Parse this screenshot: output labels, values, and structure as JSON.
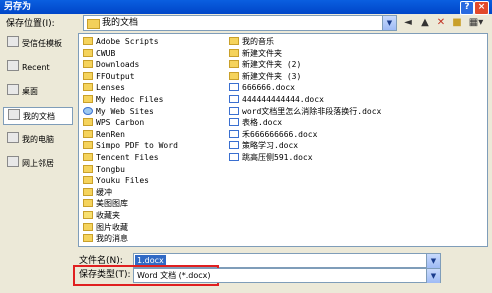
{
  "window": {
    "title": "另存为",
    "help_label": "?",
    "close_label": "×"
  },
  "location": {
    "label": "保存位置(I):",
    "value": "我的文档"
  },
  "toolbar": {
    "icons": [
      "back-icon",
      "up-folder-icon",
      "delete-icon",
      "new-folder-icon",
      "views-icon"
    ]
  },
  "places": [
    {
      "label": "受信任模板",
      "selected": false
    },
    {
      "label": "Recent",
      "selected": false
    },
    {
      "label": "桌面",
      "selected": false
    },
    {
      "label": "我的文档",
      "selected": true
    },
    {
      "label": "我的电脑",
      "selected": false
    },
    {
      "label": "网上邻居",
      "selected": false
    }
  ],
  "files_col1": [
    {
      "name": "Adobe Scripts",
      "type": "folder"
    },
    {
      "name": "CWUB",
      "type": "folder"
    },
    {
      "name": "Downloads",
      "type": "folder"
    },
    {
      "name": "FFOutput",
      "type": "folder"
    },
    {
      "name": "Lenses",
      "type": "folder"
    },
    {
      "name": "My Hedoc Files",
      "type": "folder"
    },
    {
      "name": "My Web Sites",
      "type": "web"
    },
    {
      "name": "WPS Carbon",
      "type": "folder"
    },
    {
      "name": "RenRen",
      "type": "folder"
    },
    {
      "name": "Simpo PDF to Word",
      "type": "folder"
    },
    {
      "name": "Tencent Files",
      "type": "folder"
    },
    {
      "name": "Tongbu",
      "type": "folder"
    },
    {
      "name": "Youku Files",
      "type": "folder"
    },
    {
      "name": "缓冲",
      "type": "folder"
    },
    {
      "name": "美图图库",
      "type": "folder"
    },
    {
      "name": "收藏夹",
      "type": "star"
    },
    {
      "name": "图片收藏",
      "type": "folder"
    },
    {
      "name": "我的消息",
      "type": "folder"
    }
  ],
  "files_col2": [
    {
      "name": "我的音乐",
      "type": "folder"
    },
    {
      "name": "新建文件夹",
      "type": "folder"
    },
    {
      "name": "新建文件夹 (2)",
      "type": "folder"
    },
    {
      "name": "新建文件夹 (3)",
      "type": "folder"
    },
    {
      "name": "666666.docx",
      "type": "doc"
    },
    {
      "name": "444444444444.docx",
      "type": "doc"
    },
    {
      "name": "word文档里怎么消除非段落换行.docx",
      "type": "doc"
    },
    {
      "name": "表格.docx",
      "type": "doc"
    },
    {
      "name": "禾666666666.docx",
      "type": "doc"
    },
    {
      "name": "策略学习.docx",
      "type": "doc"
    },
    {
      "name": "跳高压侧591.docx",
      "type": "doc"
    }
  ],
  "filename": {
    "label": "文件名(N):",
    "value": "1.docx"
  },
  "filetype": {
    "label": "保存类型(T):",
    "value": "Word 文档 (*.docx)"
  },
  "colors": {
    "highlight": "#e02020",
    "selection": "#316ac5",
    "titlebar": "#0a5fe0"
  }
}
